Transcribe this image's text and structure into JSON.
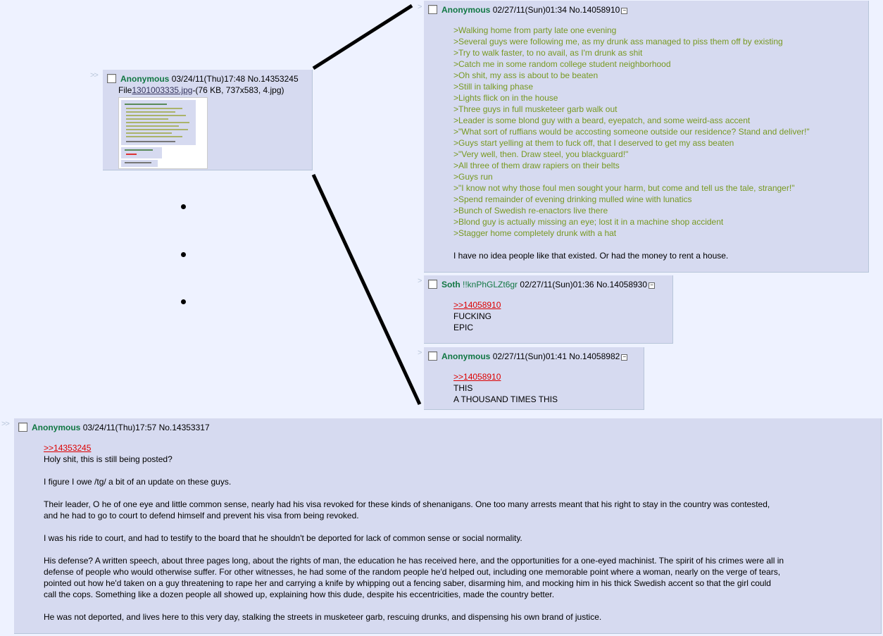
{
  "post_a": {
    "arrow": ">>",
    "name": "Anonymous",
    "datetime": "03/24/11(Thu)17:48",
    "number": "No.14353245",
    "file_label": "File",
    "file_link": "1301003335.jpg",
    "file_info": "-(76 KB, 737x583, 4.jpg)"
  },
  "post_b": {
    "arrow": ">",
    "name": "Anonymous",
    "datetime": "02/27/11(Sun)01:34",
    "number": "No.14058910",
    "lines": [
      ">Walking home from party late one evening",
      ">Several guys were following me, as my drunk ass managed to piss them off by existing",
      ">Try to walk faster, to no avail, as I'm drunk as shit",
      ">Catch me in some random college student neighborhood",
      ">Oh shit, my ass is about to be beaten",
      ">Still in talking phase",
      ">Lights flick on in the house",
      ">Three guys in full musketeer garb walk out",
      ">Leader is some blond guy with a beard, eyepatch, and some weird-ass accent",
      ">\"What sort of ruffians would be accosting someone outside our residence? Stand and deliver!\"",
      ">Guys start yelling at them to fuck off, that I deserved to get my ass beaten",
      ">\"Very well, then. Draw steel, you blackguard!\"",
      ">All three of them draw rapiers on their belts",
      ">Guys run",
      ">\"I know not why those foul men sought your harm, but come and tell us the tale, stranger!\"",
      ">Spend remainder of evening drinking mulled wine with lunatics",
      ">Bunch of Swedish re-enactors live there",
      ">Blond guy is actually missing an eye; lost it in a machine shop accident",
      ">Stagger home completely drunk with a hat"
    ],
    "closing": "I have no idea people like that existed. Or had the money to rent a house."
  },
  "post_c": {
    "arrow": ">",
    "name": "Soth",
    "tripcode": "!!knPhGLZt6gr",
    "datetime": "02/27/11(Sun)01:36",
    "number": "No.14058930",
    "reply_link": ">>14058910",
    "lines": [
      "FUCKING",
      "EPIC"
    ]
  },
  "post_d": {
    "arrow": ">",
    "name": "Anonymous",
    "datetime": "02/27/11(Sun)01:41",
    "number": "No.14058982",
    "reply_link": ">>14058910",
    "lines": [
      "THIS",
      "A THOUSAND TIMES THIS"
    ]
  },
  "post_e": {
    "arrow": ">>",
    "name": "Anonymous",
    "datetime": "03/24/11(Thu)17:57",
    "number": "No.14353317",
    "reply_link": ">>14353245",
    "p1": "Holy shit, this is still being posted?",
    "p2": "I figure I owe /tg/ a bit of an update on these guys.",
    "p3_l1": "Their leader, O he of one eye and little common sense, nearly had his visa revoked for these kinds of shenanigans. One too many arrests meant that his right to stay in the country was contested,",
    "p3_l2": "and he had to go to court to defend himself and prevent his visa from being revoked.",
    "p4": "I was his ride to court, and had to testify to the board that he shouldn't be deported for lack of common sense or social normality.",
    "p5_l1": "His defense? A written speech, about three pages long, about the rights of man, the education he has received here, and the opportunities for a one-eyed machinist. The spirit of his crimes were all in",
    "p5_l2": "defense of people who would otherwise suffer. For other witnesses, he had some of the random people he'd helped out, including one memorable point where a woman, nearly on the verge of tears,",
    "p5_l3": "pointed out how he'd taken on a guy threatening to rape her and carrying a knife by whipping out a fencing saber, disarming him, and mocking him in his thick Swedish accent so that the girl could",
    "p5_l4": "call the cops. Something like a dozen people all showed up, explaining how this dude, despite his eccentricities, made the country better.",
    "p6": "He was not deported, and lives here to this very day, stalking the streets in musketeer garb, rescuing drunks, and dispensing his own brand of justice."
  }
}
